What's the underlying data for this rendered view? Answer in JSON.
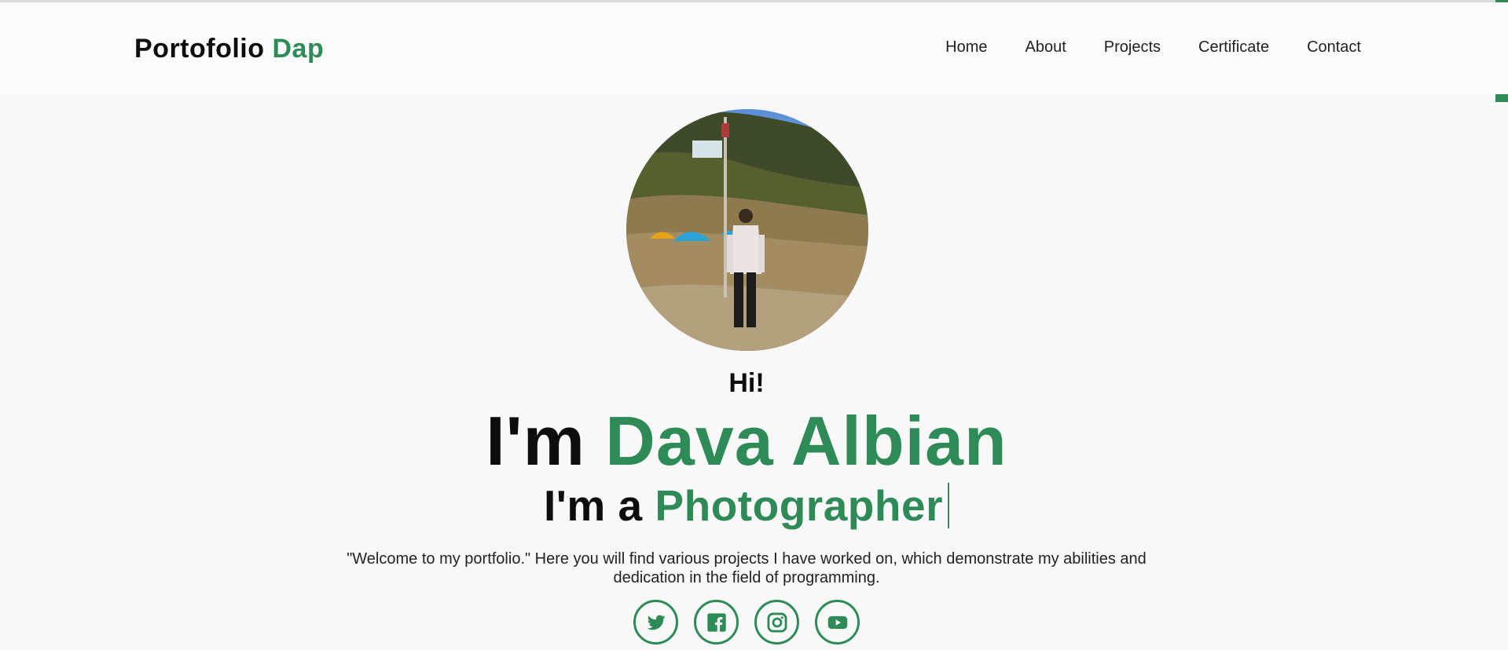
{
  "brand": {
    "name": "Portofolio",
    "accent": "Dap"
  },
  "nav": {
    "items": [
      "Home",
      "About",
      "Projects",
      "Certificate",
      "Contact"
    ]
  },
  "hero": {
    "greeting": "Hi!",
    "name_prefix": "I'm",
    "name": "Dava Albian",
    "role_prefix": "I'm a",
    "role": "Photographer",
    "description": "\"Welcome to my portfolio.\" Here you will find various projects I have worked on, which demonstrate my abilities and dedication in the field of programming."
  },
  "socials": [
    "twitter-icon",
    "facebook-icon",
    "instagram-icon",
    "youtube-icon"
  ],
  "colors": {
    "accent": "#2e8b57",
    "background": "#f8f8f9",
    "text": "#0d0d0d"
  }
}
